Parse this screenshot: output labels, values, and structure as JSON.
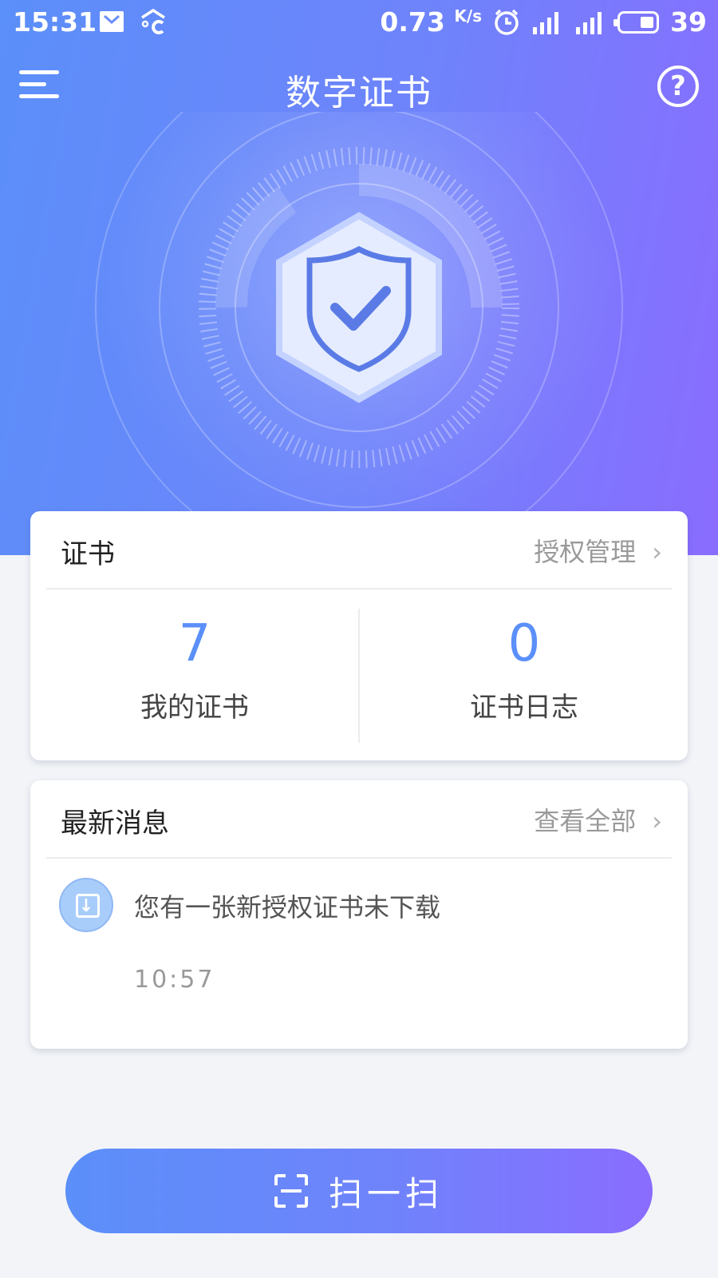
{
  "status_bar": {
    "time": "15:31",
    "speed": "0.73",
    "speed_unit": "K/s",
    "battery": "39"
  },
  "header": {
    "title": "数字证书",
    "help_symbol": "?"
  },
  "cert_card": {
    "title": "证书",
    "link_label": "授权管理",
    "chevron": "›",
    "stats": [
      {
        "value": "7",
        "label": "我的证书"
      },
      {
        "value": "0",
        "label": "证书日志"
      }
    ]
  },
  "message_card": {
    "title": "最新消息",
    "link_label": "查看全部",
    "chevron": "›",
    "items": [
      {
        "text": "您有一张新授权证书未下载",
        "time": "10:57",
        "icon": "download-icon"
      }
    ]
  },
  "scan_button": {
    "label": "扫一扫",
    "icon": "scan-icon"
  },
  "colors": {
    "gradient_start": "#5b8ff9",
    "gradient_end": "#8a6cff",
    "accent": "#5b8ff9",
    "background": "#f2f4f8"
  },
  "icons": {
    "status_left": [
      "mail-icon",
      "weather-icon"
    ],
    "status_right": [
      "alarm-icon",
      "signal-3g-icon",
      "signal-h-icon",
      "battery-icon"
    ],
    "hero": "shield-check-icon"
  }
}
